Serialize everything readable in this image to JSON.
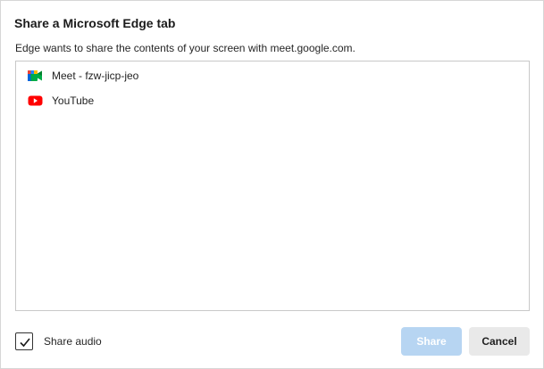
{
  "dialog": {
    "title": "Share a Microsoft Edge tab",
    "subtitle": "Edge wants to share the contents of your screen with meet.google.com."
  },
  "tabs": [
    {
      "label": "Meet - fzw-jicp-jeo",
      "icon": "google-meet-icon"
    },
    {
      "label": "YouTube",
      "icon": "youtube-icon"
    }
  ],
  "share_audio": {
    "label": "Share audio",
    "checked": true
  },
  "buttons": {
    "share_label": "Share",
    "share_enabled": false,
    "cancel_label": "Cancel"
  },
  "colors": {
    "share_button_disabled": "#b7d5f2",
    "cancel_button": "#e9e9e9",
    "youtube_red": "#ff0000"
  }
}
